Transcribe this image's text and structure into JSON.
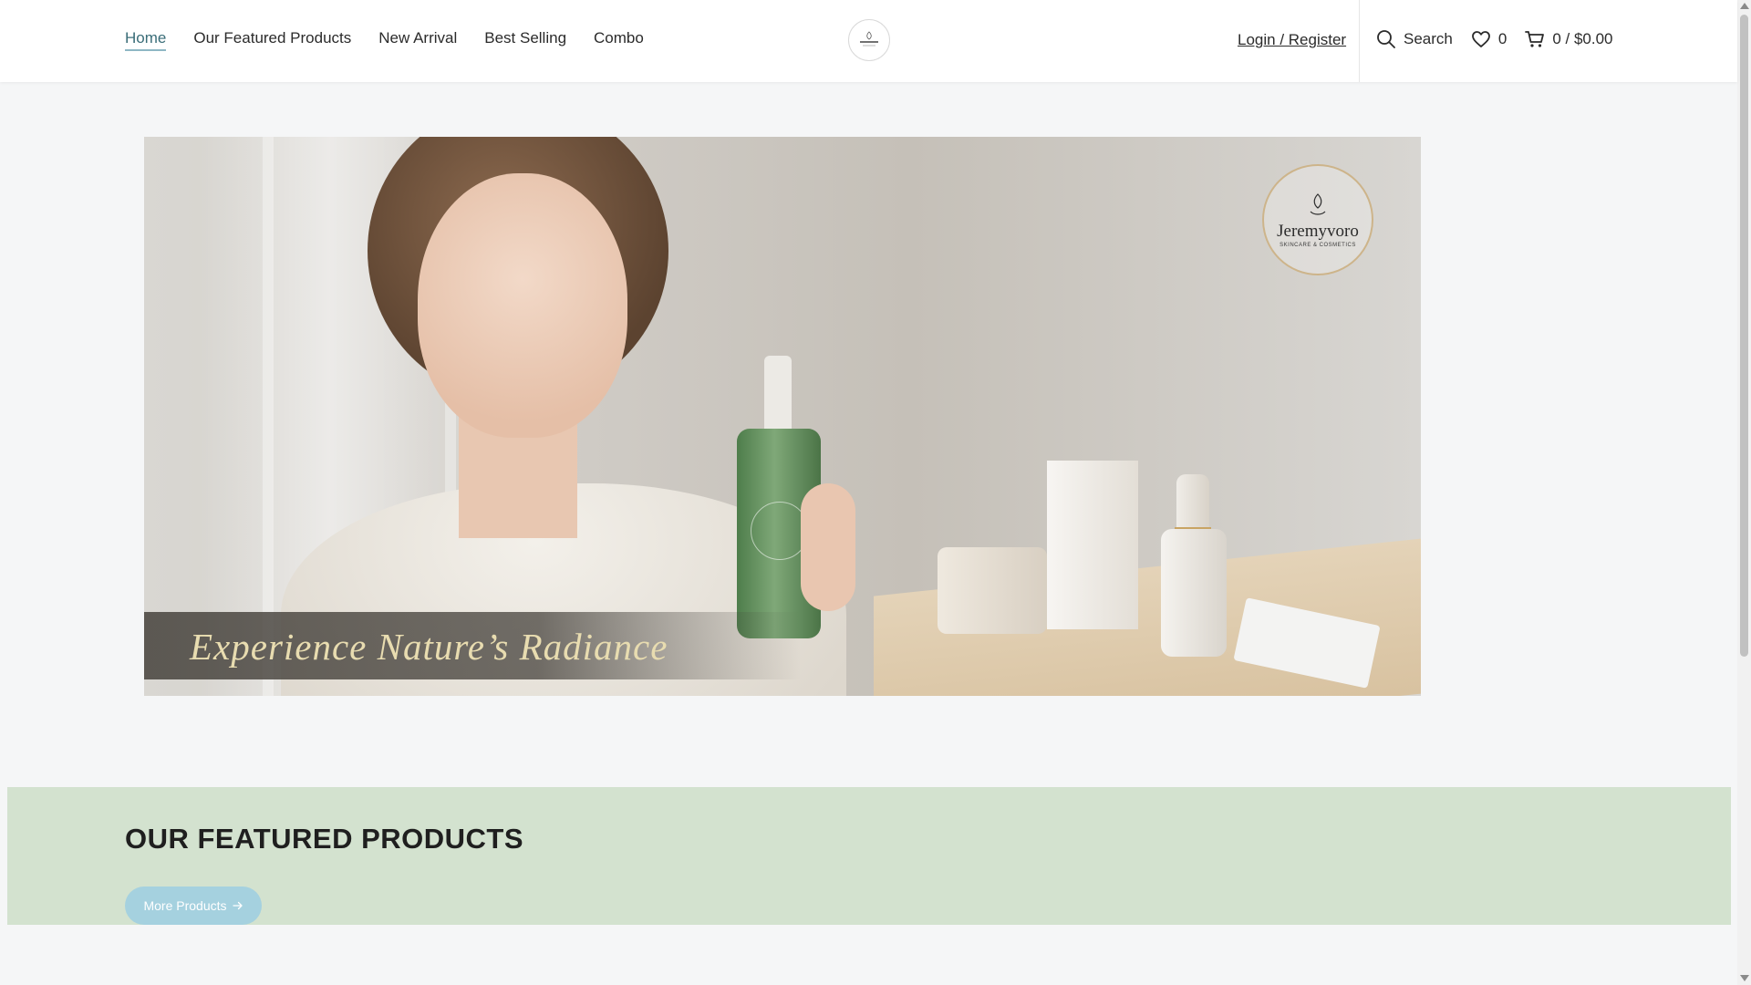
{
  "header": {
    "nav": [
      {
        "label": "Home",
        "active": true
      },
      {
        "label": "Our Featured Products",
        "active": false
      },
      {
        "label": "New Arrival",
        "active": false
      },
      {
        "label": "Best Selling",
        "active": false
      },
      {
        "label": "Combo",
        "active": false
      }
    ],
    "logo_icon": "brand-logo",
    "login_label": "Login / Register",
    "search_label": "Search",
    "wishlist_count": "0",
    "cart_summary": "0 / $0.00"
  },
  "hero": {
    "caption": "Experience Nature’s Radiance",
    "brand_name": "Jeremyvoro",
    "brand_sub": "SKINCARE & COSMETICS"
  },
  "featured": {
    "title": "OUR FEATURED PRODUCTS",
    "button_label": "More Products"
  },
  "colors": {
    "accent": "#a5d1df",
    "featured_bg": "#d3e2cf",
    "active_nav": "#3a6d78",
    "page_bg": "#f5f6f7"
  }
}
